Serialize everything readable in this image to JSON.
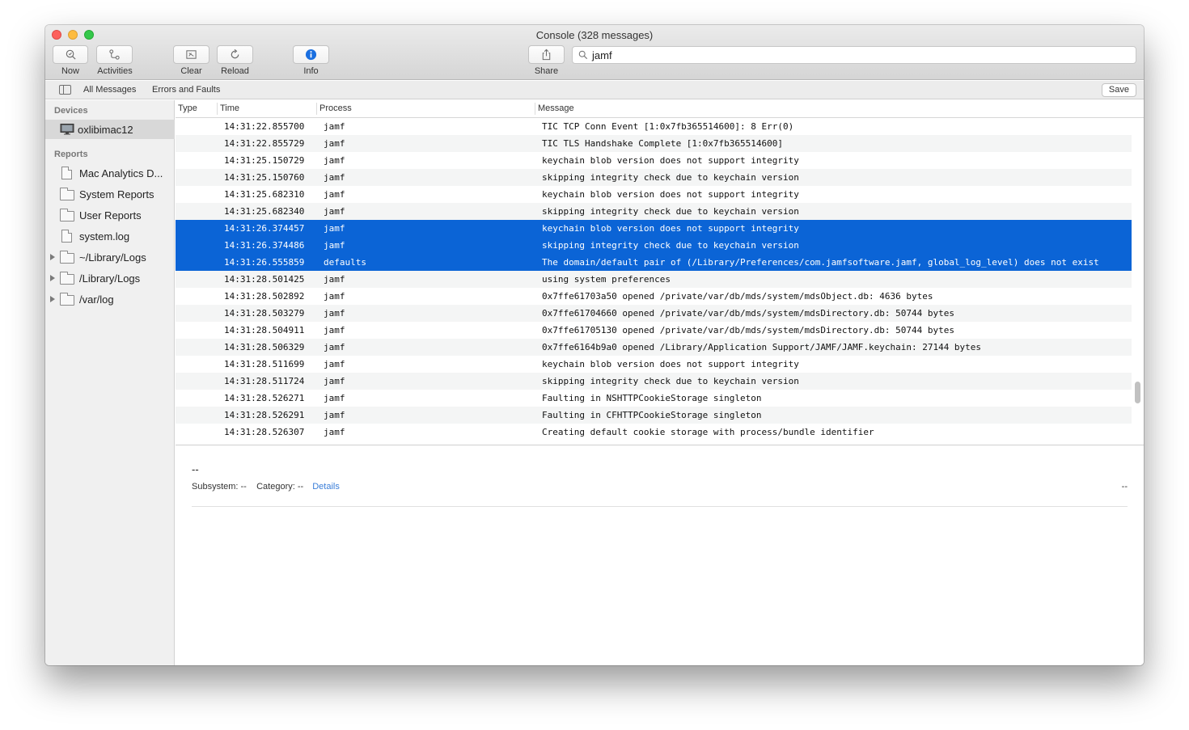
{
  "window": {
    "title": "Console (328 messages)"
  },
  "toolbar": {
    "now_label": "Now",
    "activities_label": "Activities",
    "clear_label": "Clear",
    "reload_label": "Reload",
    "info_label": "Info",
    "share_label": "Share"
  },
  "search": {
    "value": "jamf"
  },
  "filterbar": {
    "all_messages": "All Messages",
    "errors_faults": "Errors and Faults",
    "save": "Save"
  },
  "sidebar": {
    "devices_header": "Devices",
    "device": "oxlibimac12",
    "reports_header": "Reports",
    "reports": [
      {
        "label": "Mac Analytics D...",
        "icon": "document-icon"
      },
      {
        "label": "System Reports",
        "icon": "folder-icon"
      },
      {
        "label": "User Reports",
        "icon": "folder-icon"
      },
      {
        "label": "system.log",
        "icon": "document-icon"
      },
      {
        "label": "~/Library/Logs",
        "icon": "folder-icon"
      },
      {
        "label": "/Library/Logs",
        "icon": "folder-icon"
      },
      {
        "label": "/var/log",
        "icon": "folder-icon"
      }
    ]
  },
  "table": {
    "columns": {
      "type": "Type",
      "time": "Time",
      "process": "Process",
      "message": "Message"
    },
    "rows": [
      {
        "time": "14:31:22.855700",
        "process": "jamf",
        "message": "TIC TCP Conn Event [1:0x7fb365514600]: 8 Err(0)"
      },
      {
        "time": "14:31:22.855729",
        "process": "jamf",
        "message": "TIC TLS Handshake Complete [1:0x7fb365514600]"
      },
      {
        "time": "14:31:25.150729",
        "process": "jamf",
        "message": "keychain blob version does not support integrity"
      },
      {
        "time": "14:31:25.150760",
        "process": "jamf",
        "message": "skipping integrity check due to keychain version"
      },
      {
        "time": "14:31:25.682310",
        "process": "jamf",
        "message": "keychain blob version does not support integrity"
      },
      {
        "time": "14:31:25.682340",
        "process": "jamf",
        "message": "skipping integrity check due to keychain version"
      },
      {
        "time": "14:31:26.374457",
        "process": "jamf",
        "message": "keychain blob version does not support integrity"
      },
      {
        "time": "14:31:26.374486",
        "process": "jamf",
        "message": "skipping integrity check due to keychain version"
      },
      {
        "time": "14:31:26.555859",
        "process": "defaults",
        "message": "The domain/default pair of (/Library/Preferences/com.jamfsoftware.jamf, global_log_level) does not exist"
      },
      {
        "time": "14:31:28.501425",
        "process": "jamf",
        "message": "using system preferences"
      },
      {
        "time": "14:31:28.502892",
        "process": "jamf",
        "message": "0x7ffe61703a50 opened /private/var/db/mds/system/mdsObject.db: 4636 bytes"
      },
      {
        "time": "14:31:28.503279",
        "process": "jamf",
        "message": "0x7ffe61704660 opened /private/var/db/mds/system/mdsDirectory.db: 50744 bytes"
      },
      {
        "time": "14:31:28.504911",
        "process": "jamf",
        "message": "0x7ffe61705130 opened /private/var/db/mds/system/mdsDirectory.db: 50744 bytes"
      },
      {
        "time": "14:31:28.506329",
        "process": "jamf",
        "message": "0x7ffe6164b9a0 opened /Library/Application Support/JAMF/JAMF.keychain: 27144 bytes"
      },
      {
        "time": "14:31:28.511699",
        "process": "jamf",
        "message": "keychain blob version does not support integrity"
      },
      {
        "time": "14:31:28.511724",
        "process": "jamf",
        "message": "skipping integrity check due to keychain version"
      },
      {
        "time": "14:31:28.526271",
        "process": "jamf",
        "message": "Faulting in NSHTTPCookieStorage singleton"
      },
      {
        "time": "14:31:28.526291",
        "process": "jamf",
        "message": "Faulting in CFHTTPCookieStorage singleton"
      },
      {
        "time": "14:31:28.526307",
        "process": "jamf",
        "message": "Creating default cookie storage with process/bundle identifier"
      }
    ]
  },
  "details": {
    "title": "--",
    "subsystem_label": "Subsystem: --",
    "category_label": "Category: --",
    "details_link": "Details",
    "right_value": "--"
  },
  "colors": {
    "selection": "#0b64d6",
    "info_accent": "#1a6fe0",
    "link": "#3a7ed9"
  }
}
